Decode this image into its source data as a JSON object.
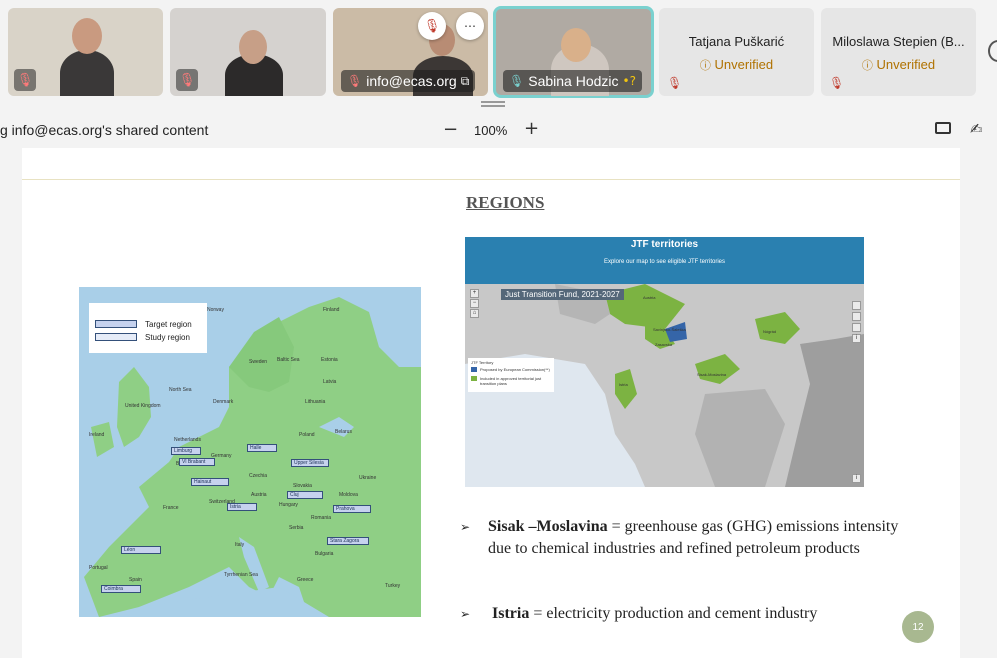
{
  "participants": [
    {
      "name": "",
      "muted": true
    },
    {
      "name": "",
      "muted": true
    },
    {
      "name": "info@ecas.org",
      "muted": true,
      "sharing": true
    },
    {
      "name": "Sabina Hodzic",
      "muted": false,
      "speaking": true
    },
    {
      "name": "Tatjana Puškarić",
      "status": "Unverified"
    },
    {
      "name": "Miloslawa Stepien (B...",
      "status": "Unverified"
    }
  ],
  "share_bar": {
    "title": "g info@ecas.org's shared content",
    "zoom_minus": "−",
    "zoom_level": "100%",
    "zoom_plus": "+"
  },
  "slide": {
    "title": "REGIONS",
    "map_legend": {
      "target": "Target region",
      "study": "Study region"
    },
    "map_labels": {
      "norway": "Norway",
      "finland": "Finland",
      "sweden": "Sweden",
      "estonia": "Estonia",
      "latvia": "Latvia",
      "lithuania": "Lithuania",
      "belarus": "Belarus",
      "north_sea": "North Sea",
      "baltic_sea": "Baltic Sea",
      "denmark": "Denmark",
      "uk": "United Kingdom",
      "ireland": "Ireland",
      "netherlands": "Netherlands",
      "belgium": "Belgium",
      "germany": "Germany",
      "poland": "Poland",
      "czechia": "Czechia",
      "slovakia": "Slovakia",
      "ukraine": "Ukraine",
      "austria": "Austria",
      "hungary": "Hungary",
      "moldova": "Moldova",
      "france": "France",
      "switzerland": "Switzerland",
      "romania": "Romania",
      "serbia": "Serbia",
      "bulgaria": "Bulgaria",
      "italy": "Italy",
      "spain": "Spain",
      "portugal": "Portugal",
      "greece": "Greece",
      "turkey": "Turkey",
      "tyrrhenian_sea": "Tyrrhenian Sea"
    },
    "target_regions": [
      "Limburg",
      "Vl Brabant",
      "Halle",
      "Upper Silesia",
      "Hainaut",
      "Cluj",
      "Istria",
      "Prahova",
      "Stara Zagora",
      "Léon",
      "Coimbra"
    ],
    "jtf_map": {
      "title": "JTF territories",
      "subtitle": "Explore our map to see eligible JTF territories",
      "tag": "Just Transition Fund, 2021-2027",
      "legend_title": "JTF Territory",
      "legend_proposed": "Proposed by European Commission(**)",
      "legend_included": "Included in approved territorial just transition plans",
      "regions": [
        "Austria",
        "Savinjsko-Šaleška",
        "Zasavska",
        "Istria",
        "Sisak-Moslavina",
        "Nógrád"
      ]
    },
    "bullets": [
      {
        "bold": "Sisak –Moslavina",
        "text": " = greenhouse gas (GHG) emissions intensity due to chemical industries and refined petroleum products"
      },
      {
        "bold": "Istria",
        "text": " = electricity production and cement industry"
      }
    ],
    "page_number": "12"
  },
  "colors": {
    "speaking_outline": "#7ad1cf",
    "jtf_green": "#7cb342",
    "jtf_blue": "#2a80b0",
    "unverified": "#b07200"
  }
}
